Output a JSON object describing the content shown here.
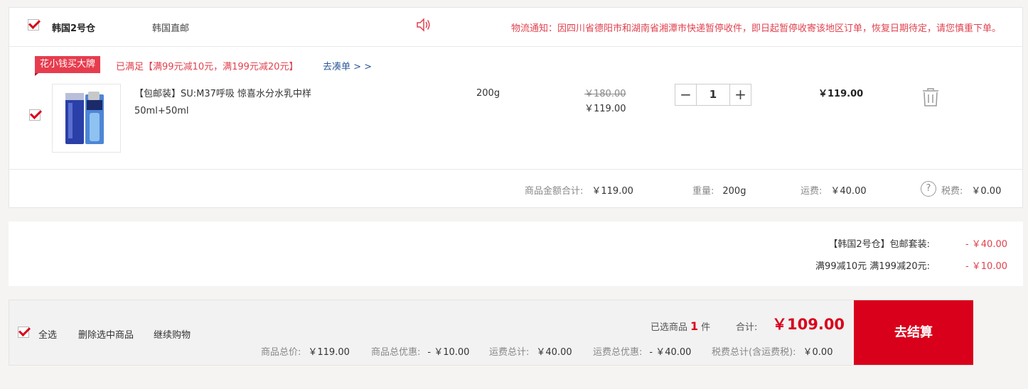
{
  "warehouse": {
    "name": "韩国2号仓",
    "type": "韩国直邮",
    "notice": "物流通知：因四川省德阳市和湖南省湘潭市快递暂停收件，即日起暂停收寄该地区订单，恢复日期待定，请您慎重下单。"
  },
  "promotion": {
    "tag": "花小钱买大牌",
    "text": "已满足【满99元减10元，满199元减20元】",
    "link": "去凑单 > >"
  },
  "item": {
    "title_line1": "【包邮装】SU:M37呼吸 惊喜水分水乳中样",
    "title_line2": "50ml+50ml",
    "weight": "200g",
    "price_original": "￥180.00",
    "price_current": "￥119.00",
    "quantity": "1",
    "subtotal": "￥119.00"
  },
  "summary": {
    "goods_label": "商品金额合计:",
    "goods_value": "￥119.00",
    "weight_label": "重量:",
    "weight_value": "200g",
    "shipping_label": "运费:",
    "shipping_value": "￥40.00",
    "tax_label": "税费:",
    "tax_value": "￥0.00"
  },
  "discounts": [
    {
      "label": "【韩国2号仓】包邮套装:",
      "value": "- ￥40.00"
    },
    {
      "label": "满99减10元 满199减20元:",
      "value": "- ￥10.00"
    }
  ],
  "footer": {
    "select_all": "全选",
    "delete_selected": "删除选中商品",
    "continue_shopping": "继续购物",
    "selected_prefix": "已选商品",
    "selected_count": "1",
    "selected_suffix": "件",
    "total_label": "合计:",
    "total_value": "￥109.00",
    "goods_total_label": "商品总价:",
    "goods_total_value": "￥119.00",
    "goods_discount_label": "商品总优惠:",
    "goods_discount_value": "- ￥10.00",
    "shipping_total_label": "运费总计:",
    "shipping_total_value": "￥40.00",
    "shipping_discount_label": "运费总优惠:",
    "shipping_discount_value": "- ￥40.00",
    "tax_total_label": "税费总计(含运费税):",
    "tax_total_value": "￥0.00",
    "checkout": "去结算"
  },
  "colors": {
    "accent": "#d9001b",
    "notice": "#e0424f",
    "link": "#2c5a9a"
  }
}
